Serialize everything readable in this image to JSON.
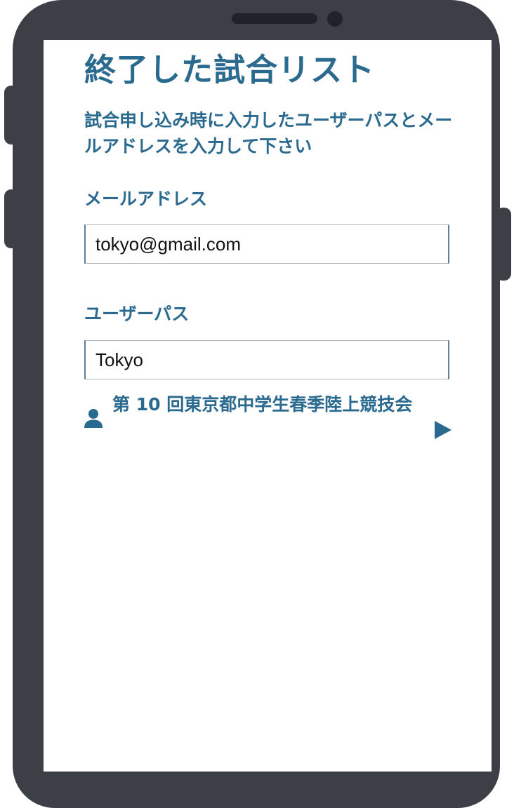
{
  "screen": {
    "title": "終了した試合リスト",
    "instructions": "試合申し込み時に入力したユーザーパスとメールアドレスを入力して下さい",
    "email": {
      "label": "メールアドレス",
      "value": "tokyo@gmail.com"
    },
    "password": {
      "label": "ユーザーパス",
      "value": "Tokyo"
    },
    "events": [
      {
        "name": "第 10 回東京都中学生春季陸上競技会",
        "icon": "person-icon",
        "action_icon": "play-arrow-icon"
      }
    ]
  },
  "colors": {
    "accent": "#2b6a8f",
    "device": "#3d3f47",
    "screen": "#ffffff"
  }
}
